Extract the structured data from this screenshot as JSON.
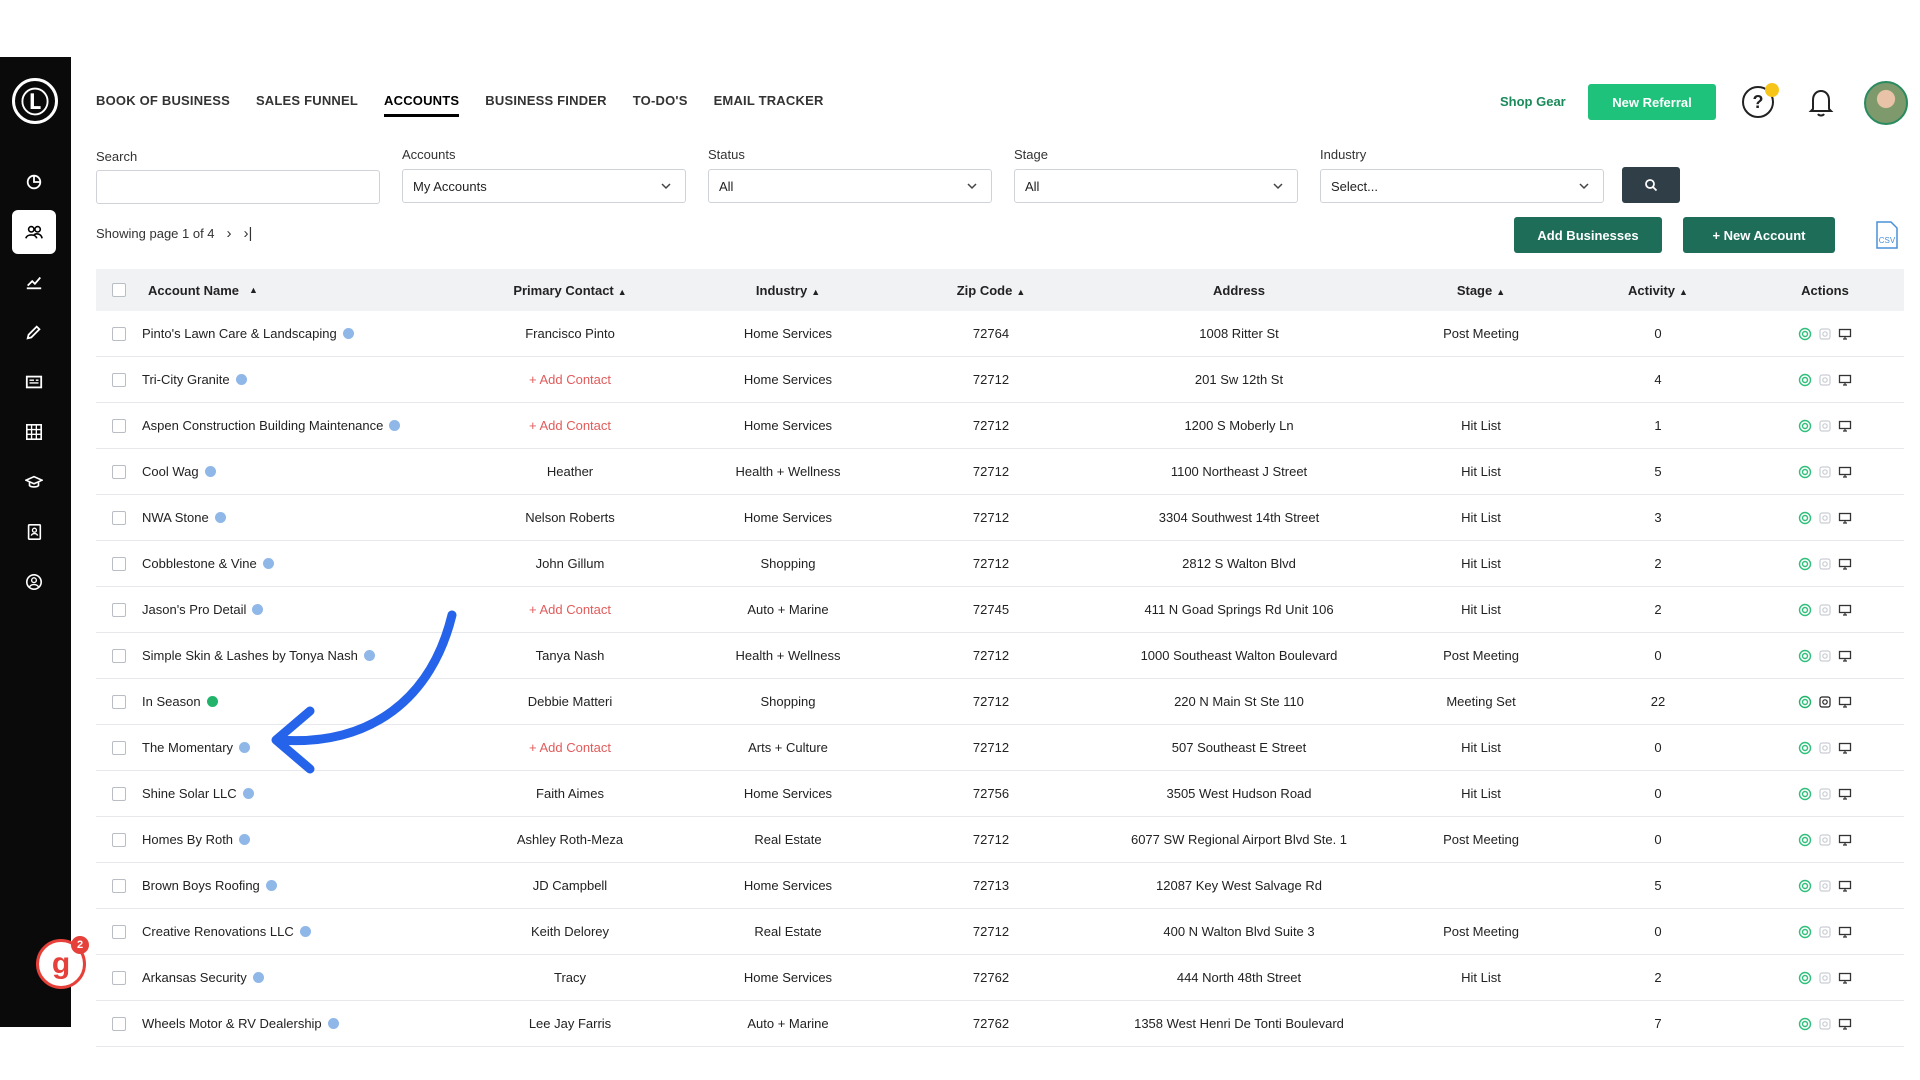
{
  "nav": {
    "items": [
      {
        "label": "BOOK OF BUSINESS",
        "active": false
      },
      {
        "label": "SALES FUNNEL",
        "active": false
      },
      {
        "label": "ACCOUNTS",
        "active": true
      },
      {
        "label": "BUSINESS FINDER",
        "active": false
      },
      {
        "label": "TO-DO'S",
        "active": false
      },
      {
        "label": "EMAIL TRACKER",
        "active": false
      }
    ]
  },
  "header": {
    "shop_gear": "Shop Gear",
    "new_referral": "New Referral",
    "help_glyph": "?",
    "brand_logo_glyph": "Ⓛ",
    "notification_count": "2",
    "review_logo_glyph": "g"
  },
  "sidebar": {
    "icons": [
      "dashboard-icon",
      "accounts-icon",
      "chart-icon",
      "pencil-icon",
      "newspaper-icon",
      "grid-icon",
      "graduation-icon",
      "contact-book-icon",
      "user-circle-icon"
    ],
    "active_index": 1
  },
  "filters": {
    "search_label": "Search",
    "search_value": "",
    "accounts_label": "Accounts",
    "accounts_value": "My Accounts",
    "status_label": "Status",
    "status_value": "All",
    "stage_label": "Stage",
    "stage_value": "All",
    "industry_label": "Industry",
    "industry_value": "Select..."
  },
  "pagination": {
    "text": "Showing page 1 of 4",
    "next_glyph": "›",
    "last_glyph": "›|"
  },
  "actions": {
    "add_businesses": "Add Businesses",
    "new_account": "+ New Account",
    "csv_label": "CSV"
  },
  "table": {
    "columns": {
      "name": "Account Name",
      "contact": "Primary Contact",
      "industry": "Industry",
      "zip": "Zip Code",
      "address": "Address",
      "stage": "Stage",
      "activity": "Activity",
      "actions": "Actions"
    },
    "sort_glyph": "▲",
    "rows": [
      {
        "name": "Pinto's Lawn Care & Landscaping",
        "badge": "blue",
        "contact": "Francisco Pinto",
        "add": false,
        "industry": "Home Services",
        "zip": "72764",
        "address": "1008 Ritter St",
        "stage": "Post Meeting",
        "activity": "0"
      },
      {
        "name": "Tri-City Granite",
        "badge": "blue",
        "contact": "+ Add Contact",
        "add": true,
        "industry": "Home Services",
        "zip": "72712",
        "address": "201 Sw 12th St",
        "stage": "",
        "activity": "4"
      },
      {
        "name": "Aspen Construction Building Maintenance",
        "badge": "blue",
        "contact": "+ Add Contact",
        "add": true,
        "industry": "Home Services",
        "zip": "72712",
        "address": "1200 S Moberly Ln",
        "stage": "Hit List",
        "activity": "1"
      },
      {
        "name": "Cool Wag",
        "badge": "blue",
        "contact": "Heather",
        "add": false,
        "industry": "Health + Wellness",
        "zip": "72712",
        "address": "1100 Northeast J Street",
        "stage": "Hit List",
        "activity": "5"
      },
      {
        "name": "NWA Stone",
        "badge": "blue",
        "contact": "Nelson Roberts",
        "add": false,
        "industry": "Home Services",
        "zip": "72712",
        "address": "3304 Southwest 14th Street",
        "stage": "Hit List",
        "activity": "3"
      },
      {
        "name": "Cobblestone & Vine",
        "badge": "blue",
        "contact": "John Gillum",
        "add": false,
        "industry": "Shopping",
        "zip": "72712",
        "address": "2812 S Walton Blvd",
        "stage": "Hit List",
        "activity": "2"
      },
      {
        "name": "Jason's Pro Detail",
        "badge": "blue",
        "contact": "+ Add Contact",
        "add": true,
        "industry": "Auto + Marine",
        "zip": "72745",
        "address": "411 N Goad Springs Rd Unit 106",
        "stage": "Hit List",
        "activity": "2"
      },
      {
        "name": "Simple Skin & Lashes by Tonya Nash",
        "badge": "blue",
        "contact": "Tanya Nash",
        "add": false,
        "industry": "Health + Wellness",
        "zip": "72712",
        "address": "1000 Southeast Walton Boulevard",
        "stage": "Post Meeting",
        "activity": "0"
      },
      {
        "name": "In Season",
        "badge": "green",
        "contact": "Debbie Matteri",
        "add": false,
        "industry": "Shopping",
        "zip": "72712",
        "address": "220 N Main St Ste 110",
        "stage": "Meeting Set",
        "activity": "22"
      },
      {
        "name": "The Momentary",
        "badge": "blue",
        "contact": "+ Add Contact",
        "add": true,
        "industry": "Arts + Culture",
        "zip": "72712",
        "address": "507 Southeast E Street",
        "stage": "Hit List",
        "activity": "0"
      },
      {
        "name": "Shine Solar LLC",
        "badge": "blue",
        "contact": "Faith Aimes",
        "add": false,
        "industry": "Home Services",
        "zip": "72756",
        "address": "3505 West Hudson Road",
        "stage": "Hit List",
        "activity": "0"
      },
      {
        "name": "Homes By Roth",
        "badge": "blue",
        "contact": "Ashley Roth-Meza",
        "add": false,
        "industry": "Real Estate",
        "zip": "72712",
        "address": "6077 SW Regional Airport Blvd Ste. 1",
        "stage": "Post Meeting",
        "activity": "0"
      },
      {
        "name": "Brown Boys Roofing",
        "badge": "blue",
        "contact": "JD Campbell",
        "add": false,
        "industry": "Home Services",
        "zip": "72713",
        "address": "12087 Key West Salvage Rd",
        "stage": "",
        "activity": "5"
      },
      {
        "name": "Creative Renovations LLC",
        "badge": "blue",
        "contact": "Keith Delorey",
        "add": false,
        "industry": "Real Estate",
        "zip": "72712",
        "address": "400 N Walton Blvd Suite 3",
        "stage": "Post Meeting",
        "activity": "0"
      },
      {
        "name": "Arkansas Security",
        "badge": "blue",
        "contact": "Tracy",
        "add": false,
        "industry": "Home Services",
        "zip": "72762",
        "address": "444 North 48th Street",
        "stage": "Hit List",
        "activity": "2"
      },
      {
        "name": "Wheels Motor & RV Dealership",
        "badge": "blue",
        "contact": "Lee Jay Farris",
        "add": false,
        "industry": "Auto + Marine",
        "zip": "72762",
        "address": "1358 West Henri De Tonti Boulevard",
        "stage": "",
        "activity": "7"
      }
    ]
  },
  "colors": {
    "accent_green": "#1e6d58",
    "referral_green": "#1fc27a",
    "add_contact_red": "#e25b5b",
    "annotation_arrow": "#2563eb"
  }
}
